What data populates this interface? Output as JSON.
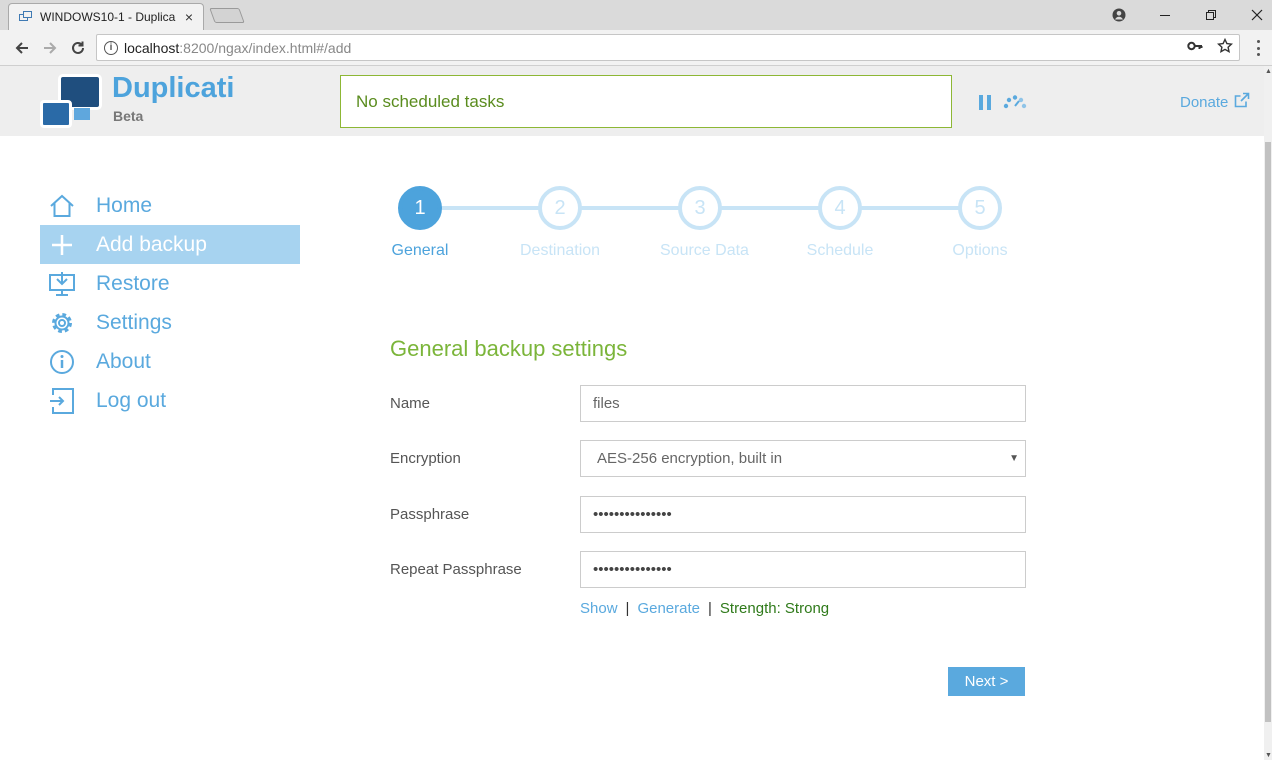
{
  "browser": {
    "tab_title": "WINDOWS10-1 - Duplica",
    "tab_close": "×",
    "url_host": "localhost",
    "url_path": ":8200/ngax/index.html#/add",
    "window_controls": [
      "minimize",
      "restore",
      "close"
    ]
  },
  "app": {
    "name": "Duplicati",
    "subtitle": "Beta",
    "status": "No scheduled tasks",
    "donate": "Donate",
    "accent_color": "#4da3dc",
    "success_color": "#7bb53a"
  },
  "sidebar": {
    "items": [
      {
        "label": "Home",
        "icon": "home-icon",
        "active": false
      },
      {
        "label": "Add backup",
        "icon": "plus-icon",
        "active": true
      },
      {
        "label": "Restore",
        "icon": "restore-icon",
        "active": false
      },
      {
        "label": "Settings",
        "icon": "gear-icon",
        "active": false
      },
      {
        "label": "About",
        "icon": "info-icon",
        "active": false
      },
      {
        "label": "Log out",
        "icon": "logout-icon",
        "active": false
      }
    ]
  },
  "wizard": {
    "steps": [
      {
        "number": "1",
        "label": "General",
        "active": true
      },
      {
        "number": "2",
        "label": "Destination",
        "active": false
      },
      {
        "number": "3",
        "label": "Source Data",
        "active": false
      },
      {
        "number": "4",
        "label": "Schedule",
        "active": false
      },
      {
        "number": "5",
        "label": "Options",
        "active": false
      }
    ]
  },
  "form": {
    "title": "General backup settings",
    "name_label": "Name",
    "name_value": "files",
    "encryption_label": "Encryption",
    "encryption_value": "AES-256 encryption, built in",
    "passphrase_label": "Passphrase",
    "passphrase_value": "•••••••••••••••",
    "repeat_label": "Repeat Passphrase",
    "repeat_value": "•••••••••••••••",
    "show_link": "Show",
    "separator": "|",
    "generate_link": "Generate",
    "strength": "Strength: Strong",
    "next_button": "Next >"
  }
}
